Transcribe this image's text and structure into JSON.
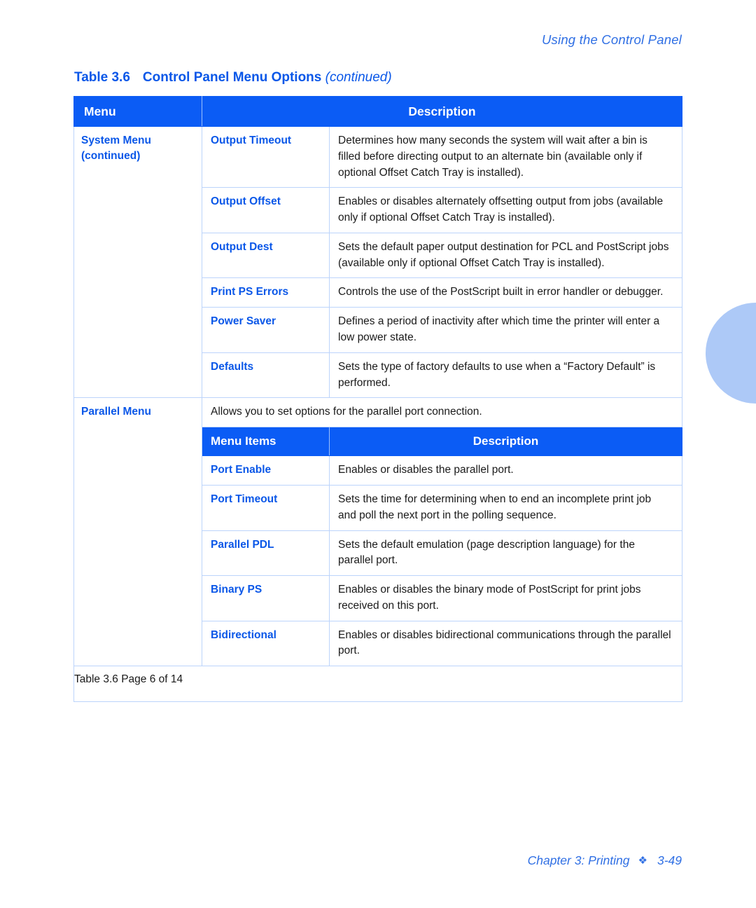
{
  "colors": {
    "accent_blue": "#0a57e8",
    "header_blue": "#0b5cf5",
    "rule_blue": "#bcd4fb",
    "tab_blue": "#adc9f7",
    "running_head_blue": "#2f6fe4"
  },
  "running_head": "Using the Control Panel",
  "caption": {
    "number": "Table 3.6",
    "title": "Control Panel Menu Options",
    "continued": "(continued)"
  },
  "table": {
    "headers": {
      "col1": "Menu",
      "col2": "Description"
    },
    "sub_headers": {
      "col1": "Menu Items",
      "col2": "Description"
    },
    "groups": [
      {
        "label_line1": "System Menu",
        "label_line2": "(continued)",
        "rows": [
          {
            "term": "Output Timeout",
            "description": "Determines how many seconds the system will wait after a bin is filled before directing output to an alternate bin (available only if optional Offset Catch Tray is installed)."
          },
          {
            "term": "Output Offset",
            "description": "Enables or disables alternately offsetting output from jobs (available only if optional Offset Catch Tray is installed)."
          },
          {
            "term": "Output Dest",
            "description": "Sets the default paper output destination for PCL and PostScript jobs (available only if optional Offset Catch Tray is installed)."
          },
          {
            "term": "Print PS Errors",
            "description": "Controls the use of the PostScript built in error handler or debugger."
          },
          {
            "term": "Power Saver",
            "description": "Defines a period of inactivity after which time the printer will enter a low power state."
          },
          {
            "term": "Defaults",
            "description": "Sets the type of factory defaults to use when a “Factory Default” is performed."
          }
        ]
      },
      {
        "label_line1": "Parallel Menu",
        "label_line2": "",
        "intro": "Allows you to set options for the parallel port connection.",
        "rows": [
          {
            "term": "Port Enable",
            "description": "Enables or disables the parallel port."
          },
          {
            "term": "Port Timeout",
            "description": "Sets the time for determining when to end an incomplete print job and poll the next port in the polling sequence."
          },
          {
            "term": "Parallel PDL",
            "description": "Sets the default emulation (page description language) for the parallel port."
          },
          {
            "term": "Binary PS",
            "description": "Enables or disables the binary mode of PostScript for print jobs received on this port."
          },
          {
            "term": "Bidirectional",
            "description": "Enables or disables bidirectional communications through the parallel port."
          }
        ]
      }
    ],
    "footer": "Table 3.6  Page 6 of 14"
  },
  "page_footer": {
    "chapter": "Chapter 3: Printing",
    "diamond": "❖",
    "folio": "3-49"
  }
}
